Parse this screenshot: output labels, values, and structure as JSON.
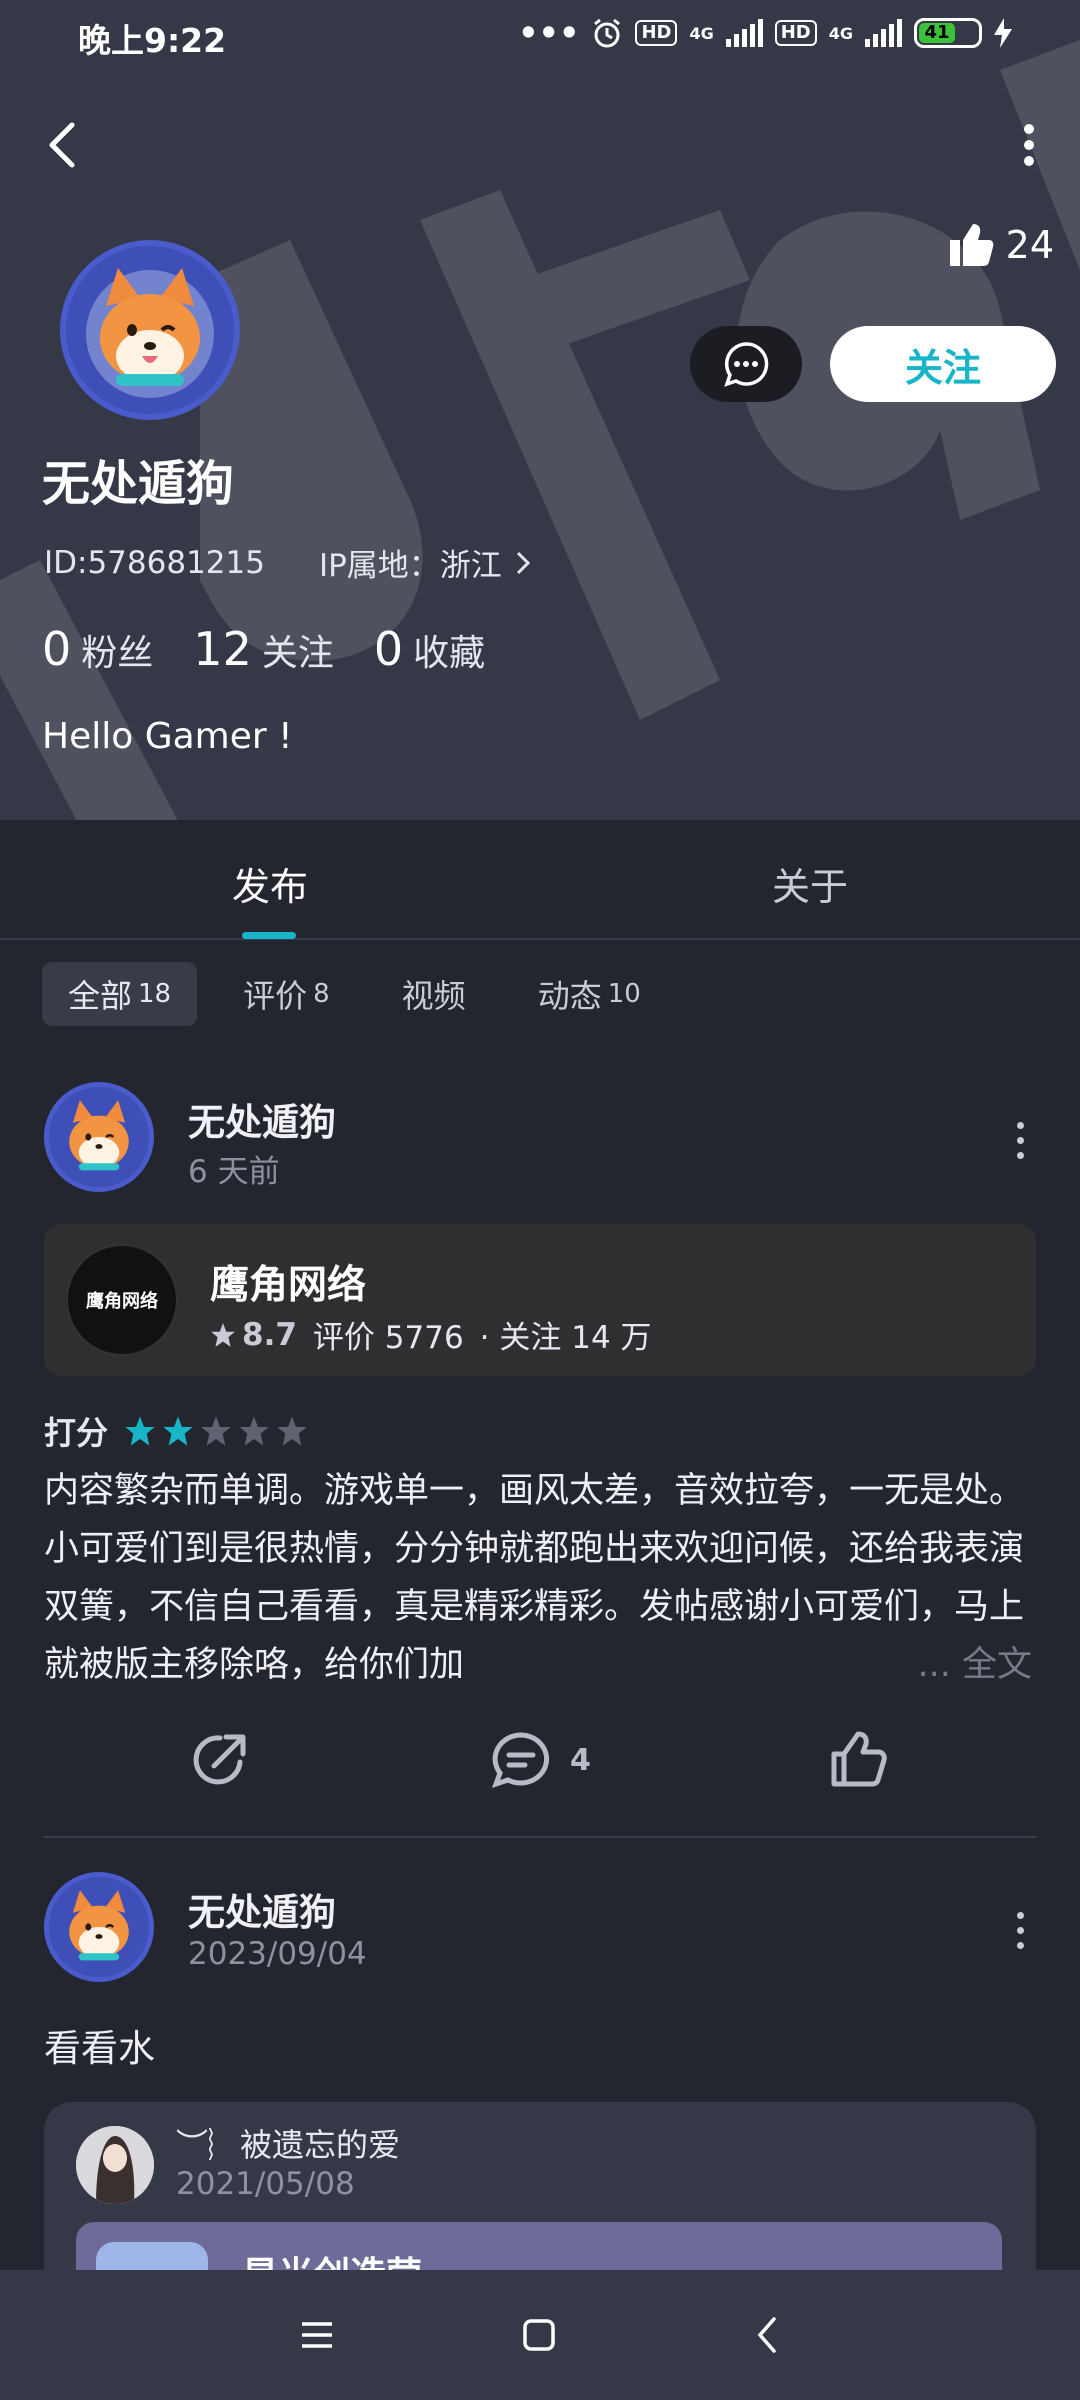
{
  "status_bar": {
    "time": "晚上9:22",
    "hd1": "HD",
    "net1": "4G",
    "hd2": "HD",
    "net2": "4G",
    "battery": "41",
    "battery_color": "#3cc13b"
  },
  "header": {
    "like_count": "24",
    "message_icon": "chat-bubble-icon",
    "follow_label": "关注",
    "accent_color": "#17b5c7"
  },
  "profile": {
    "name": "无处遁狗",
    "id_text": "ID:578681215",
    "ip_text": "IP属地：浙江",
    "stats": [
      {
        "num": "0",
        "label": "粉丝"
      },
      {
        "num": "12",
        "label": "关注"
      },
      {
        "num": "0",
        "label": "收藏"
      }
    ],
    "bio": "Hello Gamer !"
  },
  "tabs": [
    {
      "label": "发布"
    },
    {
      "label": "关于"
    }
  ],
  "filters": [
    {
      "label": "全部",
      "count": "18"
    },
    {
      "label": "评价",
      "count": "8"
    },
    {
      "label": "视频",
      "count": ""
    },
    {
      "label": "动态",
      "count": "10"
    }
  ],
  "post1": {
    "author": "无处遁狗",
    "time": "6 天前",
    "game": {
      "name": "鹰角网络",
      "logo_text": "鹰角网络",
      "score": "8.7",
      "reviews": "评价 5776",
      "follows": "· 关注 14 万"
    },
    "rating_label": "打分",
    "rating": 2,
    "rating_max": 5,
    "text": "内容繁杂而单调。游戏单一，画风太差，音效拉夸，一无是处。小可爱们到是很热情，分分钟就都跑出来欢迎问候，还给我表演双簧，不信自己看看，真是精彩精彩。发帖感谢小可爱们，马上就被版主移除咯，给你们加",
    "more_label": "... 全文",
    "comment_count": "4"
  },
  "post2": {
    "author": "无处遁狗",
    "time": "2023/09/04",
    "text": "看看水",
    "shared": {
      "author": "︶︴被遗忘的爱",
      "time": "2021/05/08",
      "title": "星光创造营"
    }
  }
}
